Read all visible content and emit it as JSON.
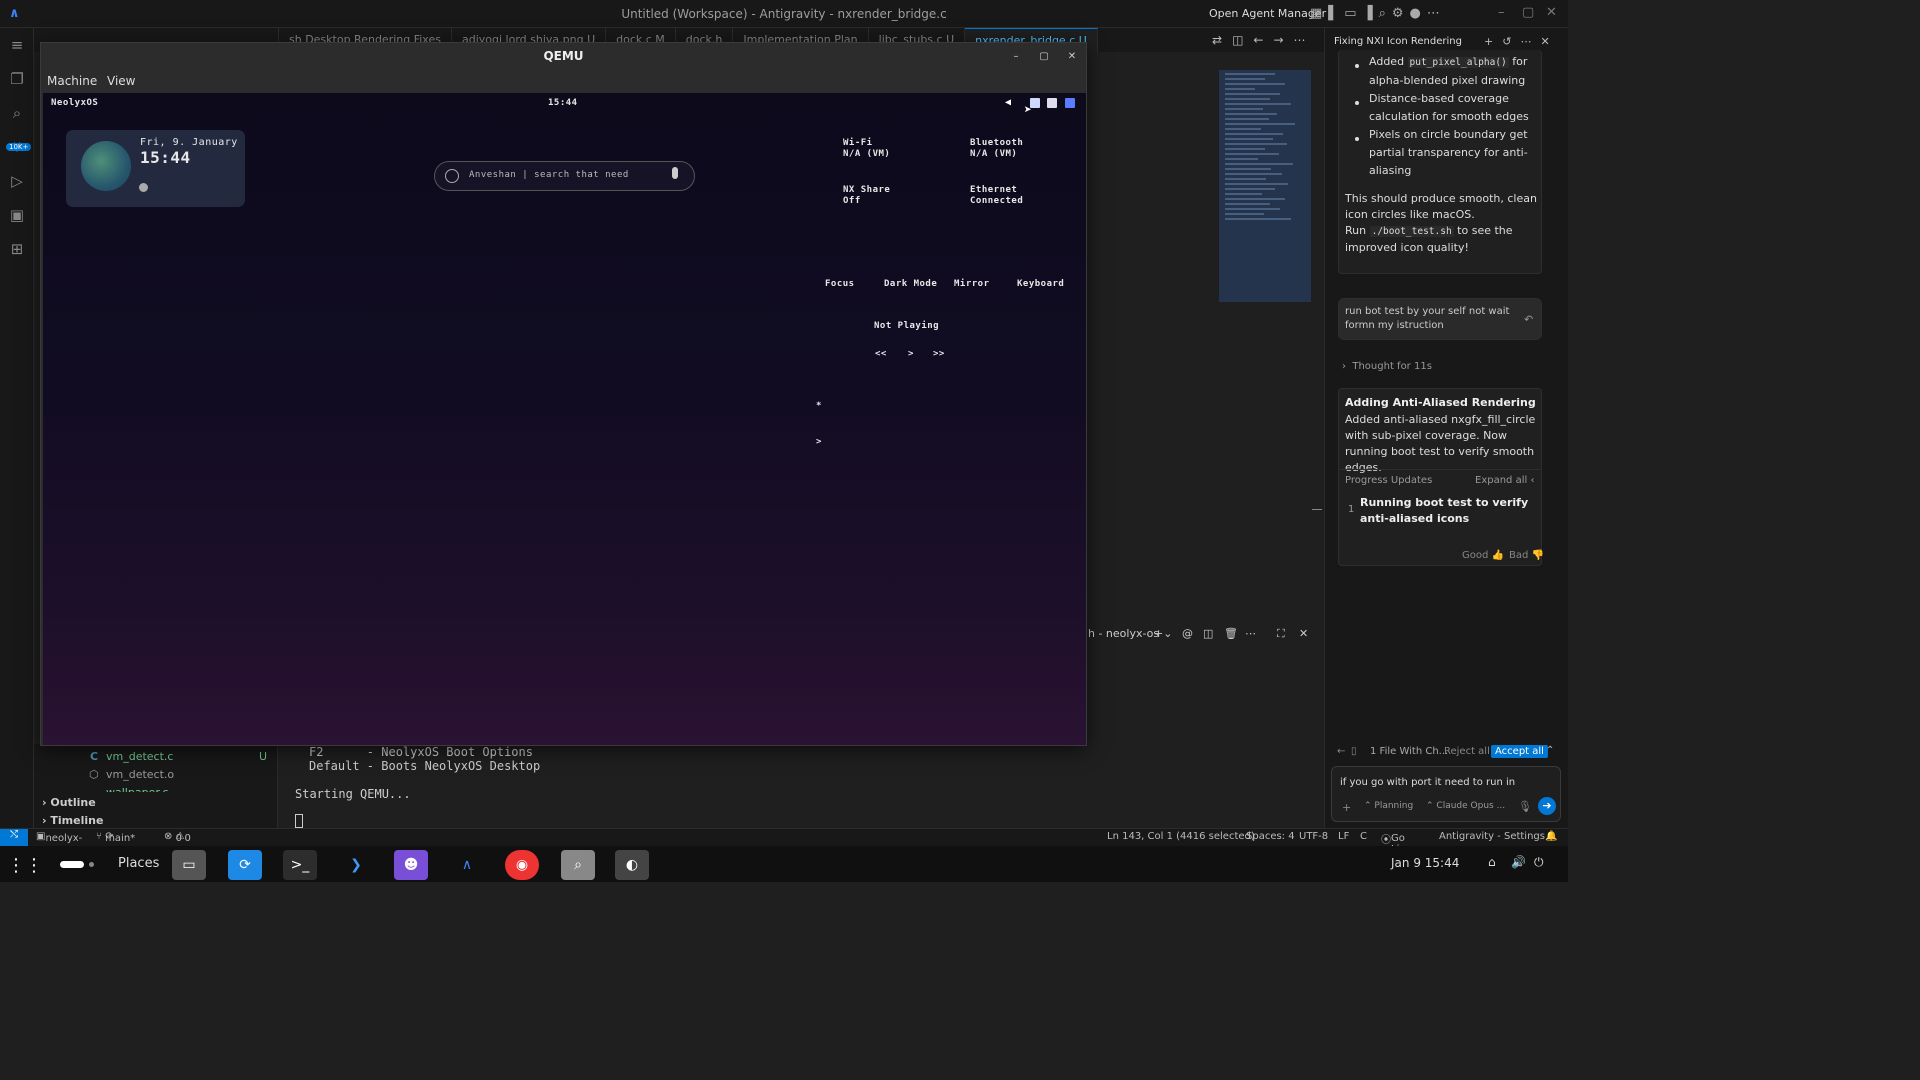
{
  "window": {
    "title": "Untitled (Workspace) - Antigravity - nxrender_bridge.c",
    "open_agent_manager": "Open Agent Manager"
  },
  "tabs": [
    "sh Desktop Rendering Fixes",
    "adiyogi lord shiva.png U",
    "dock.c M",
    "dock.h",
    "Implementation Plan",
    "libc_stubs.c U",
    "nxrender_bridge.c U"
  ],
  "activity": {
    "badge": "10K+"
  },
  "explorer": {
    "files": [
      {
        "name": "vm_detect.c",
        "status": "U"
      },
      {
        "name": "vm_detect.o",
        "status": ""
      },
      {
        "name": "wallpaper.c",
        "status": "U"
      }
    ],
    "sections": [
      "Outline",
      "Timeline"
    ]
  },
  "terminal": {
    "panel_title": "h - neolyx-os",
    "lines": [
      "F2      - NeolyxOS Boot Options",
      "Default - Boots NeolyxOS Desktop",
      "",
      "Starting QEMU..."
    ]
  },
  "qemu": {
    "title": "QEMU",
    "menu": [
      "Machine",
      "View"
    ],
    "vm": {
      "os_name": "NeolyxOS",
      "top_clock": "15:44",
      "date": "Fri, 9. January",
      "clock": "15:44",
      "search_placeholder": "Anveshan | search that need",
      "quick_settings": [
        {
          "name": "Wi-Fi",
          "status": "N/A (VM)"
        },
        {
          "name": "Bluetooth",
          "status": "N/A (VM)"
        },
        {
          "name": "NX Share",
          "status": "Off"
        },
        {
          "name": "Ethernet",
          "status": "Connected"
        }
      ],
      "toggles": [
        "Focus",
        "Dark Mode",
        "Mirror",
        "Keyboard"
      ],
      "media": {
        "status": "Not Playing",
        "prev": "<<",
        "play": ">",
        "next": ">>"
      },
      "extra": [
        "*",
        ">"
      ]
    }
  },
  "agent": {
    "header": "Fixing NXI Icon Rendering",
    "bullets": [
      {
        "pre": "Added ",
        "code": "put_pixel_alpha()",
        "post": " for alpha-blended pixel drawing"
      },
      {
        "pre": "Distance-based coverage calculation for smooth edges",
        "code": "",
        "post": ""
      },
      {
        "pre": "Pixels on circle boundary get partial transparency for anti-aliasing",
        "code": "",
        "post": ""
      }
    ],
    "summary_1": "This should produce smooth, clean icon circles like macOS.",
    "summary_run": "Run ",
    "summary_code": "./boot_test.sh",
    "summary_2": " to see the improved icon quality!",
    "user_message": "run bot  test by your self not wait formn my istruction",
    "thought": "Thought for 11s",
    "step_title": "Adding Anti-Aliased Rendering",
    "step_body": "Added anti-aliased nxgfx_fill_circle with sub-pixel coverage. Now running boot test to verify smooth edges.",
    "progress_label": "Progress Updates",
    "expand_all": "Expand all",
    "progress_num": "1",
    "progress_text": "Running boot test to verify anti-aliased icons",
    "good": "Good",
    "bad": "Bad",
    "files_changed": "1 File With Ch...",
    "reject_all": "Reject all",
    "accept_all": "Accept all",
    "input_text": "if you go with port it need to run in",
    "mode": "Planning",
    "model": "Claude Opus ..."
  },
  "status": {
    "workspace": "neolyx-os",
    "branch": "main*",
    "problems": "0",
    "warnings": "0",
    "position": "Ln 143, Col 1 (4416 selected)",
    "spaces": "Spaces: 4",
    "encoding": "UTF-8",
    "eol": "LF",
    "lang": "C",
    "golive": "Go Live",
    "settings": "Antigravity - Settings"
  },
  "taskbar": {
    "places": "Places",
    "clock": "Jan 9  15:44"
  },
  "colors": {
    "accent": "#0078d4",
    "vm_bg": "#110c22",
    "added": "#73c991"
  }
}
